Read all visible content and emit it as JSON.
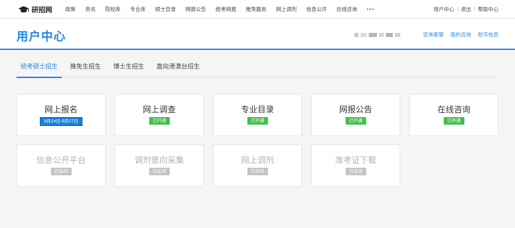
{
  "site": {
    "logo_text": "研招网"
  },
  "nav": {
    "items": [
      "政策",
      "资讯",
      "院校库",
      "专业库",
      "硕士目录",
      "网报公告",
      "统考网报",
      "推免服务",
      "网上调剂",
      "信息公开",
      "在线咨询"
    ],
    "more": "•••"
  },
  "user_links": {
    "center": "用户中心",
    "logout": "退出",
    "help": "帮助中心",
    "separator": "|"
  },
  "header": {
    "title": "用户中心",
    "links": [
      "咨询客服",
      "我的咨询",
      "账号信息"
    ]
  },
  "tabs": [
    "统考硕士招生",
    "推免生招生",
    "博士生招生",
    "面向港澳台招生"
  ],
  "cards": [
    {
      "title": "网上报名",
      "badge": "9月24日-9月27日",
      "status": "date"
    },
    {
      "title": "网上调查",
      "badge": "已开通",
      "status": "open"
    },
    {
      "title": "专业目录",
      "badge": "已开通",
      "status": "open"
    },
    {
      "title": "网报公告",
      "badge": "已开通",
      "status": "open"
    },
    {
      "title": "在线咨询",
      "badge": "已开通",
      "status": "open"
    },
    {
      "title": "信息公开平台",
      "badge": "已关闭",
      "status": "closed"
    },
    {
      "title": "调剂意向采集",
      "badge": "已关闭",
      "status": "closed"
    },
    {
      "title": "网上调剂",
      "badge": "已关闭",
      "status": "closed"
    },
    {
      "title": "准考证下载",
      "badge": "已关闭",
      "status": "closed"
    }
  ],
  "colors": {
    "accent": "#1e86e5",
    "open": "#3dc14a",
    "closed": "#c4c4c4",
    "date": "#1d7fd8"
  }
}
